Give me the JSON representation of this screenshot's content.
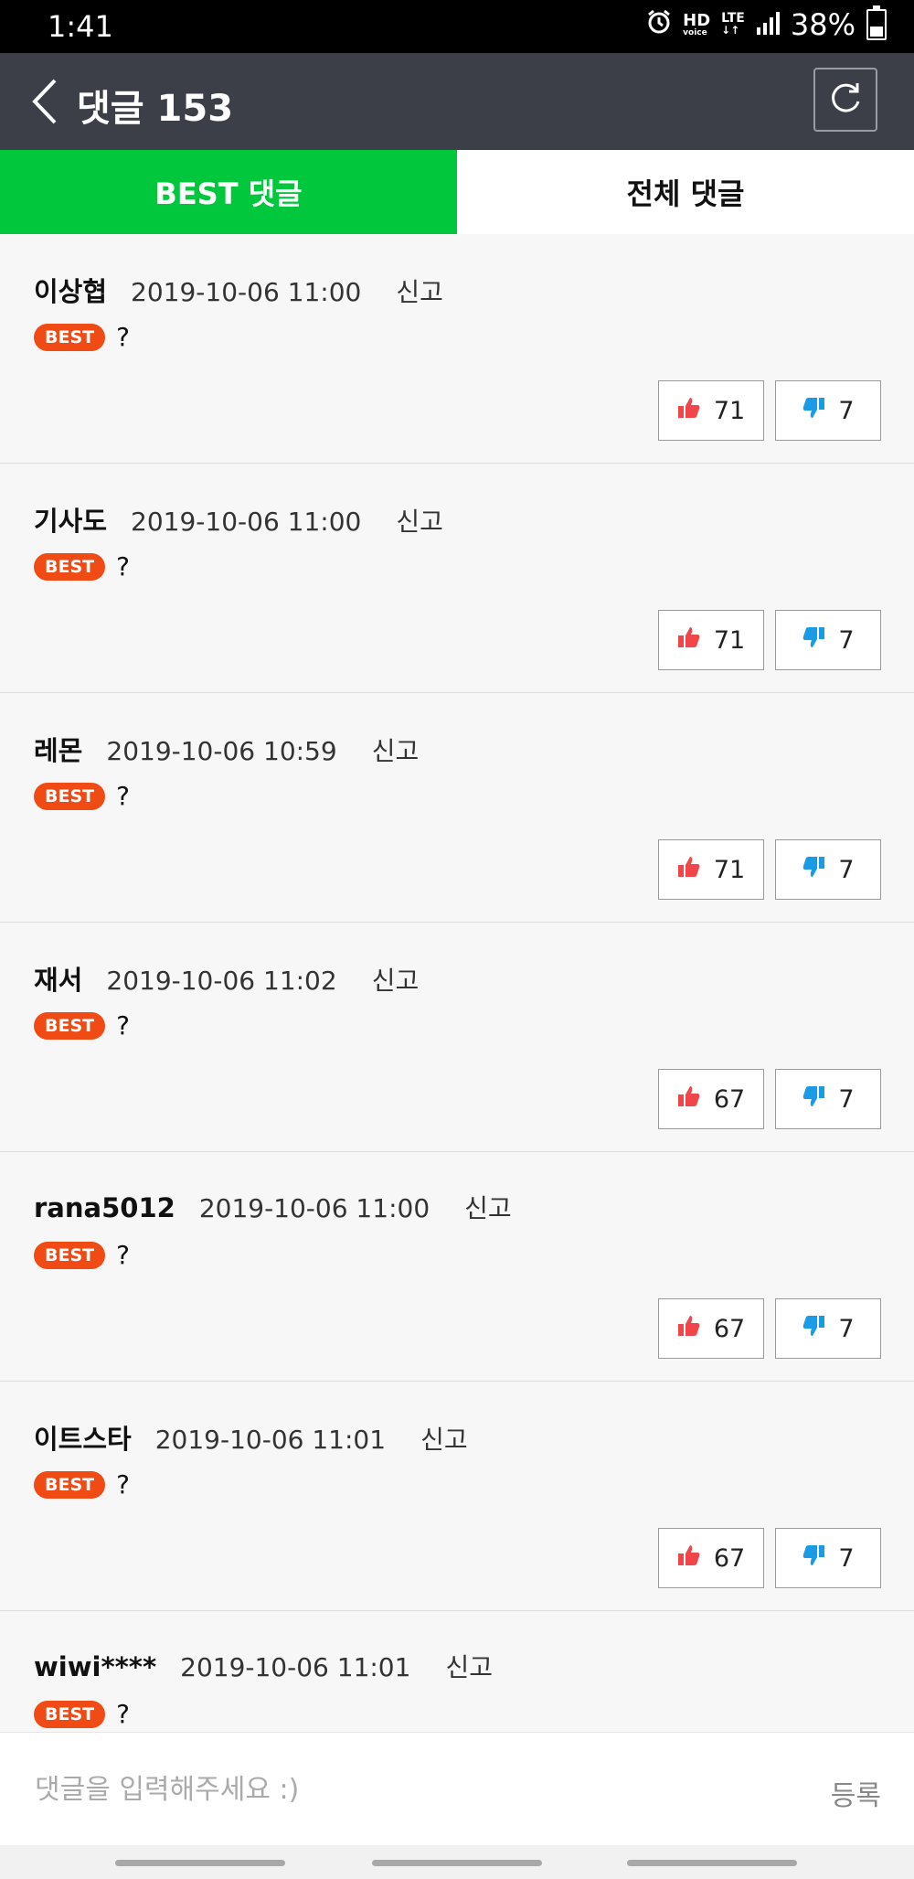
{
  "status": {
    "time": "1:41",
    "hd": "HD",
    "voice": "voice",
    "lte": "LTE",
    "battery": "38%"
  },
  "header": {
    "title": "댓글 153"
  },
  "tabs": [
    {
      "label": "BEST 댓글"
    },
    {
      "label": "전체 댓글"
    }
  ],
  "labels": {
    "best_badge": "BEST",
    "report": "신고"
  },
  "comments": [
    {
      "author": "이상협",
      "date": "2019-10-06 11:00",
      "text": "?",
      "likes": "71",
      "dislikes": "7"
    },
    {
      "author": "기사도",
      "date": "2019-10-06 11:00",
      "text": "?",
      "likes": "71",
      "dislikes": "7"
    },
    {
      "author": "레몬",
      "date": "2019-10-06 10:59",
      "text": "?",
      "likes": "71",
      "dislikes": "7"
    },
    {
      "author": "재서",
      "date": "2019-10-06 11:02",
      "text": "?",
      "likes": "67",
      "dislikes": "7"
    },
    {
      "author": "rana5012",
      "date": "2019-10-06 11:00",
      "text": "?",
      "likes": "67",
      "dislikes": "7"
    },
    {
      "author": "이트스타",
      "date": "2019-10-06 11:01",
      "text": "?",
      "likes": "67",
      "dislikes": "7"
    },
    {
      "author": "wiwi****",
      "date": "2019-10-06 11:01",
      "text": "?",
      "likes": "",
      "dislikes": ""
    }
  ],
  "input": {
    "placeholder": "댓글을 입력해주세요 :)",
    "submit": "등록"
  },
  "colors": {
    "accent_green": "#00c73c",
    "header_bg": "#3c3f48",
    "best_badge": "#f04b14",
    "like_icon": "#f0464a",
    "dislike_icon": "#1a9be6"
  }
}
